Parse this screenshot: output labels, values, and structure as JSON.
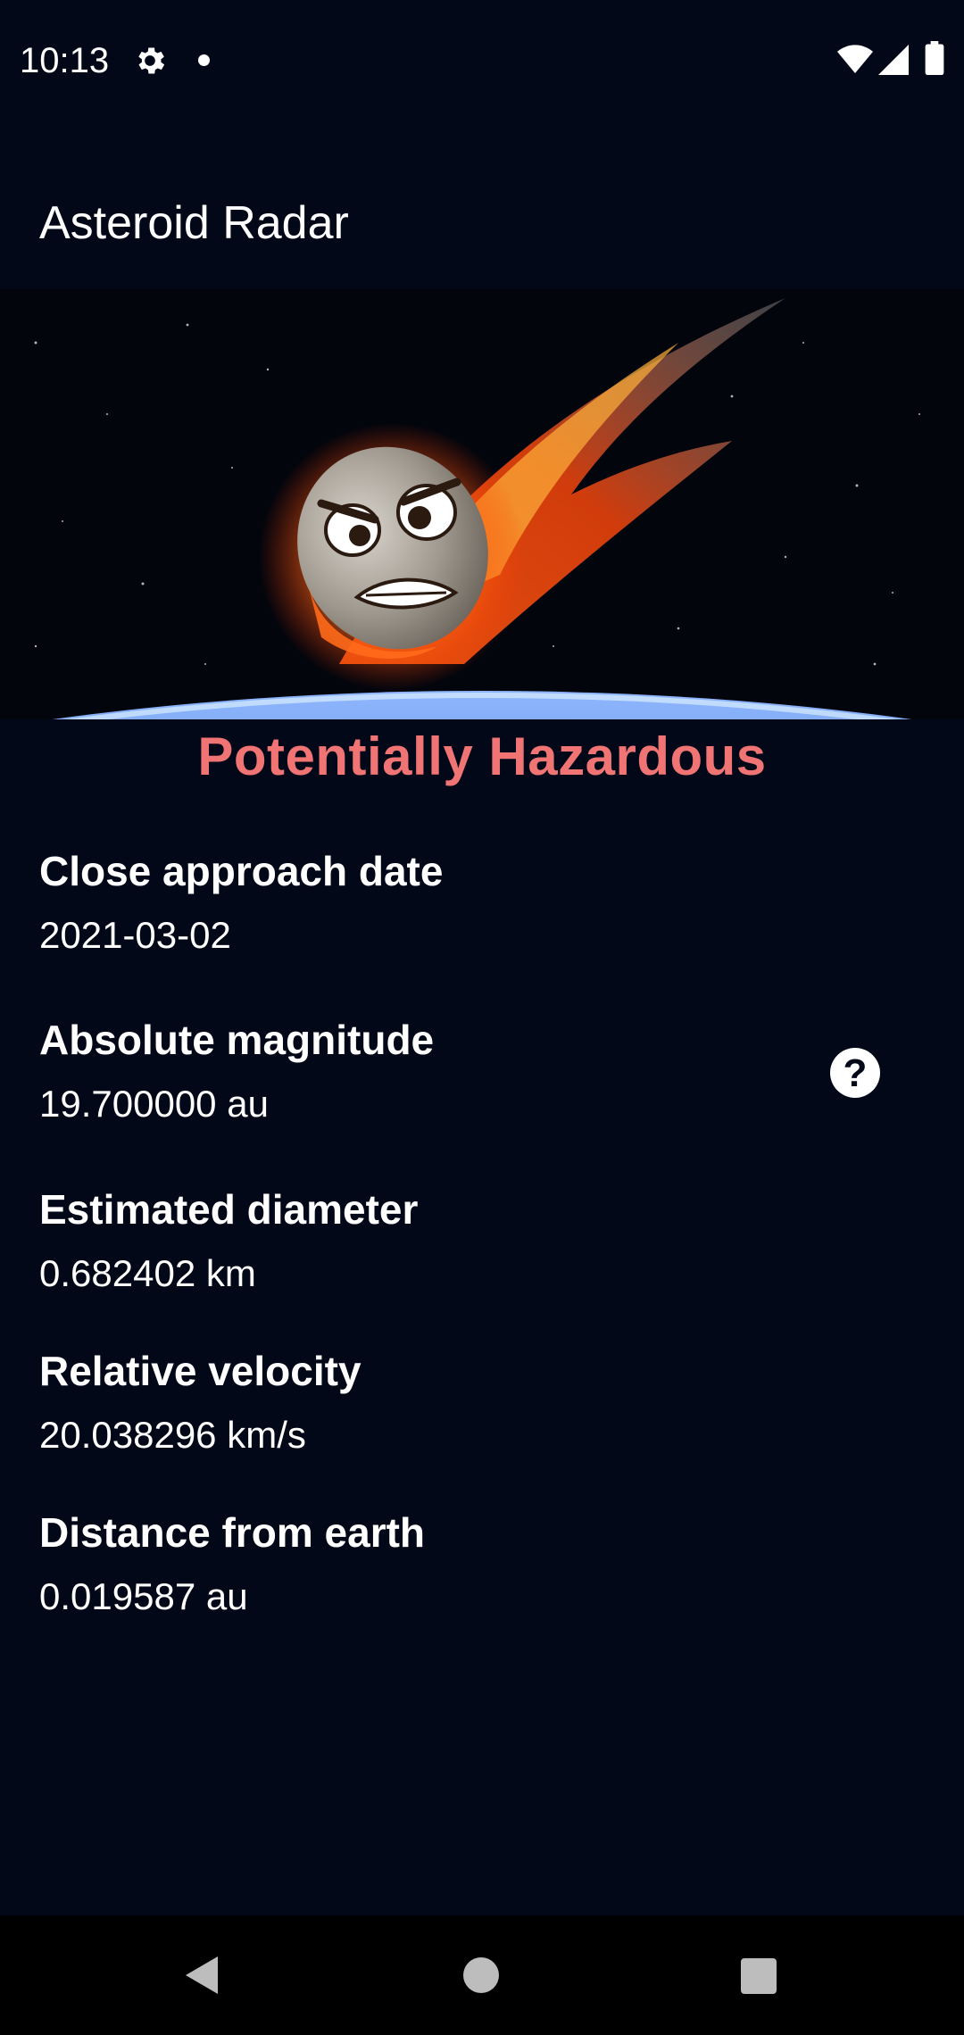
{
  "status_bar": {
    "time": "10:13",
    "icons": [
      "gear-icon",
      "notification-dot-icon",
      "wifi-icon",
      "signal-icon",
      "battery-icon"
    ]
  },
  "app_bar": {
    "title": "Asteroid Radar"
  },
  "hero": {
    "image": "angry-fireball-asteroid-over-earth-illustration"
  },
  "hazard": {
    "label": "Potentially Hazardous",
    "color": "#f07474"
  },
  "details": {
    "close_approach": {
      "label": "Close approach date",
      "value": "2021-03-02"
    },
    "absolute_magnitude": {
      "label": "Absolute magnitude",
      "value": "19.700000 au",
      "help_icon": "help-circle-icon"
    },
    "estimated_diameter": {
      "label": "Estimated diameter",
      "value": "0.682402 km"
    },
    "relative_velocity": {
      "label": "Relative velocity",
      "value": "20.038296 km/s"
    },
    "distance_from_earth": {
      "label": "Distance from earth",
      "value": "0.019587 au"
    }
  },
  "nav_bar": {
    "icons": [
      "back-icon",
      "home-icon",
      "recents-icon"
    ]
  },
  "colors": {
    "background": "#020818",
    "text": "#ffffff",
    "nav_background": "#000000"
  }
}
